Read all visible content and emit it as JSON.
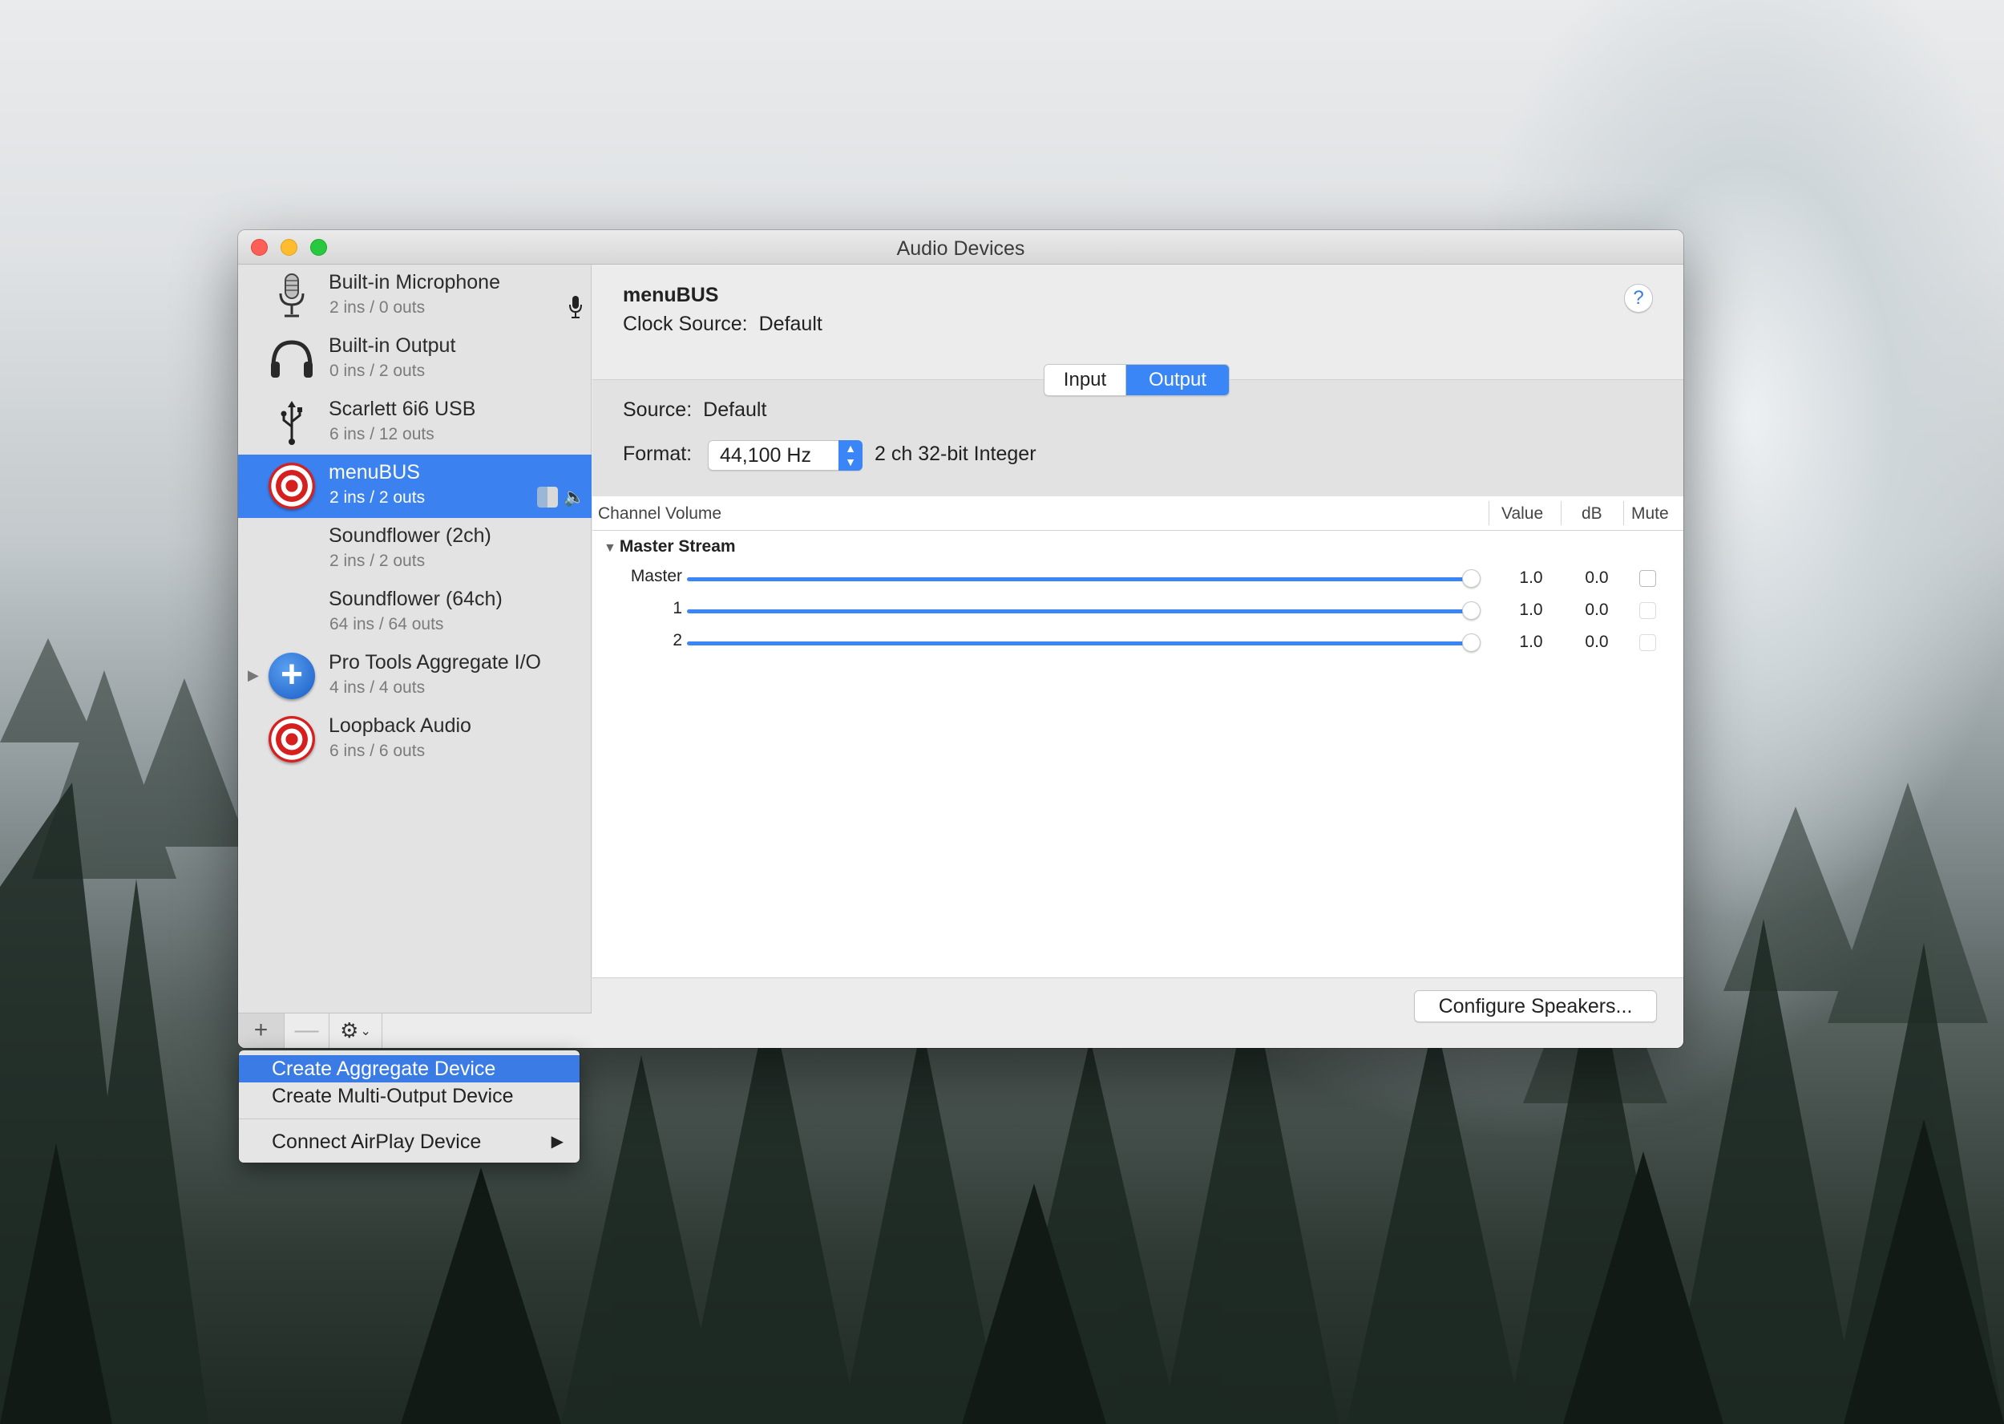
{
  "window": {
    "title": "Audio Devices"
  },
  "devices": [
    {
      "name": "Built-in Microphone",
      "sub": "2 ins / 0 outs",
      "icon": "microphone-icon"
    },
    {
      "name": "Built-in Output",
      "sub": "0 ins / 2 outs",
      "icon": "headphones-icon"
    },
    {
      "name": "Scarlett 6i6 USB",
      "sub": "6 ins / 12 outs",
      "icon": "usb-icon"
    },
    {
      "name": "menuBUS",
      "sub": "2 ins / 2 outs",
      "icon": "target-icon",
      "selected": true
    },
    {
      "name": "Soundflower (2ch)",
      "sub": "2 ins / 2 outs",
      "icon": ""
    },
    {
      "name": "Soundflower (64ch)",
      "sub": "64 ins / 64 outs",
      "icon": ""
    },
    {
      "name": "Pro Tools Aggregate I/O",
      "sub": "4 ins / 4 outs",
      "icon": "aggregate-plus-icon"
    },
    {
      "name": "Loopback Audio",
      "sub": "6 ins / 6 outs",
      "icon": "target-icon"
    }
  ],
  "sidebar_toolbar": {
    "add": "+",
    "remove": "—",
    "gear": "⚙"
  },
  "detail": {
    "device_name": "menuBUS",
    "clock_label": "Clock Source:",
    "clock_value": "Default",
    "help": "?",
    "tabs": {
      "input": "Input",
      "output": "Output",
      "active": "Output"
    },
    "source_label": "Source:",
    "source_value": "Default",
    "format_label": "Format:",
    "format_rate": "44,100 Hz",
    "format_desc": "2 ch 32-bit Integer"
  },
  "table": {
    "headers": {
      "channel": "Channel Volume",
      "value": "Value",
      "db": "dB",
      "mute": "Mute"
    },
    "group": "Master Stream",
    "rows": [
      {
        "label": "Master",
        "level": 1.0,
        "value": "1.0",
        "db": "0.0",
        "mute": false
      },
      {
        "label": "1",
        "level": 1.0,
        "value": "1.0",
        "db": "0.0",
        "mute": false
      },
      {
        "label": "2",
        "level": 1.0,
        "value": "1.0",
        "db": "0.0",
        "mute": false
      }
    ]
  },
  "configure_button": "Configure Speakers...",
  "menu": {
    "items": [
      "Create Aggregate Device",
      "Create Multi-Output Device",
      "Connect AirPlay Device"
    ],
    "highlighted": "Create Aggregate Device"
  },
  "colors": {
    "accent": "#3b86f7",
    "selection": "#3b82f0"
  }
}
